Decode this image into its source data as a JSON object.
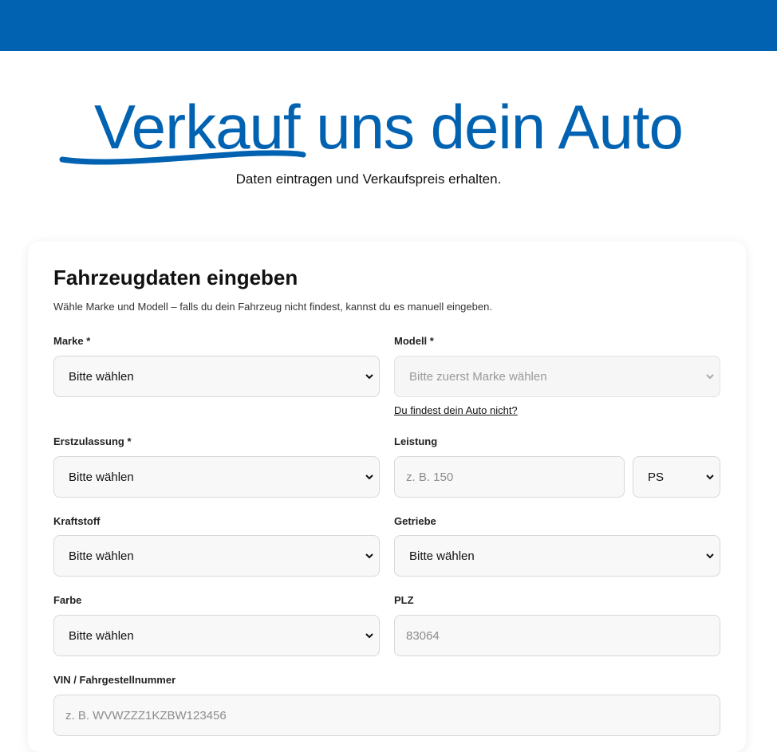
{
  "hero": {
    "title_first": "Verkauf",
    "title_rest": " uns dein Auto",
    "subtitle": "Daten eintragen und Verkaufspreis erhalten."
  },
  "form": {
    "title": "Fahrzeugdaten eingeben",
    "description": "Wähle Marke und Modell – falls du dein Fahrzeug nicht findest, kannst du es manuell eingeben.",
    "marke": {
      "label": "Marke *",
      "value": "Bitte wählen"
    },
    "modell": {
      "label": "Modell *",
      "value": "Bitte zuerst Marke wählen"
    },
    "not_found_link": "Du findest dein Auto nicht?",
    "erstzulassung": {
      "label": "Erstzulassung *",
      "value": "Bitte wählen"
    },
    "leistung": {
      "label": "Leistung",
      "placeholder": "z. B. 150",
      "unit": "PS"
    },
    "kraftstoff": {
      "label": "Kraftstoff",
      "value": "Bitte wählen"
    },
    "getriebe": {
      "label": "Getriebe",
      "value": "Bitte wählen"
    },
    "farbe": {
      "label": "Farbe",
      "value": "Bitte wählen"
    },
    "plz": {
      "label": "PLZ",
      "placeholder": "83064"
    },
    "vin": {
      "label": "VIN / Fahrgestellnummer",
      "placeholder": "z. B. WVWZZZ1KZBW123456"
    }
  },
  "colors": {
    "brand_blue": "#0162b1"
  }
}
